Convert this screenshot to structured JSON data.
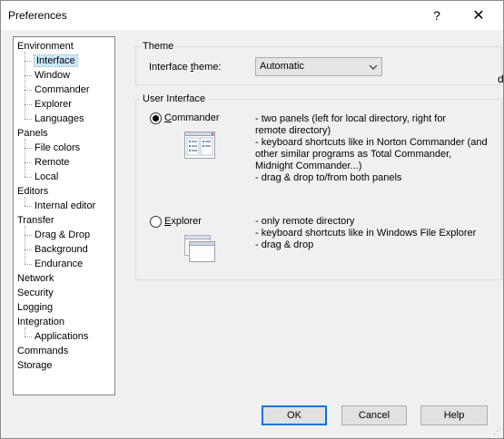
{
  "window": {
    "title": "Preferences",
    "help_glyph": "?",
    "close_glyph": "✕"
  },
  "tree": [
    {
      "label": "Environment",
      "level": 0
    },
    {
      "label": "Interface",
      "level": 1,
      "selected": true
    },
    {
      "label": "Window",
      "level": 1
    },
    {
      "label": "Commander",
      "level": 1
    },
    {
      "label": "Explorer",
      "level": 1
    },
    {
      "label": "Languages",
      "level": 1
    },
    {
      "label": "Panels",
      "level": 0
    },
    {
      "label": "File colors",
      "level": 1
    },
    {
      "label": "Remote",
      "level": 1
    },
    {
      "label": "Local",
      "level": 1
    },
    {
      "label": "Editors",
      "level": 0
    },
    {
      "label": "Internal editor",
      "level": 1
    },
    {
      "label": "Transfer",
      "level": 0
    },
    {
      "label": "Drag & Drop",
      "level": 1
    },
    {
      "label": "Background",
      "level": 1
    },
    {
      "label": "Endurance",
      "level": 1
    },
    {
      "label": "Network",
      "level": 0
    },
    {
      "label": "Security",
      "level": 0
    },
    {
      "label": "Logging",
      "level": 0
    },
    {
      "label": "Integration",
      "level": 0
    },
    {
      "label": "Applications",
      "level": 1
    },
    {
      "label": "Commands",
      "level": 0
    },
    {
      "label": "Storage",
      "level": 0
    }
  ],
  "theme": {
    "group_title": "Theme",
    "label": "Interface theme:",
    "value": "Automatic"
  },
  "ui": {
    "group_title": "User Interface",
    "commander": {
      "label": "Commander",
      "checked": true,
      "desc": [
        "- two panels (left for local directory, right for",
        "remote directory)",
        "- keyboard shortcuts like in Norton Commander (and",
        "other similar programs as Total Commander,",
        "Midnight Commander...)",
        "- drag & drop to/from both panels"
      ]
    },
    "explorer": {
      "label": "Explorer",
      "checked": false,
      "desc": [
        "- only remote directory",
        "- keyboard shortcuts like in Windows File Explorer",
        "- drag & drop"
      ]
    }
  },
  "buttons": {
    "ok": "OK",
    "cancel": "Cancel",
    "help": "Help"
  },
  "edge_char": "d"
}
